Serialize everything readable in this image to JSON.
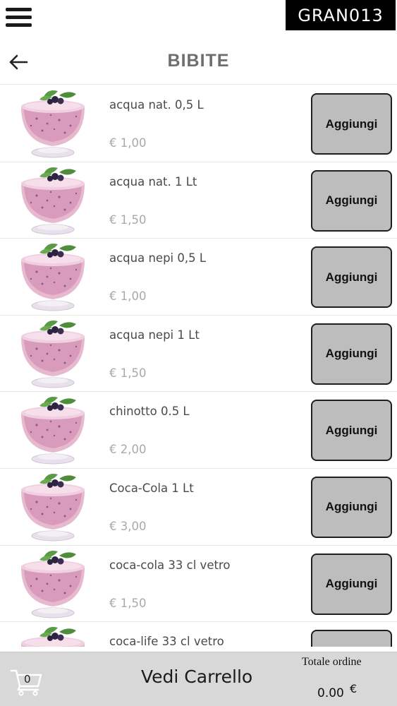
{
  "brand": {
    "logo_text": "GRAN013"
  },
  "header": {
    "title": "BIBITE"
  },
  "icons": {
    "menu": "hamburger-menu-icon",
    "back": "back-arrow-icon",
    "cart": "shopping-cart-icon",
    "product": "smoothie-glass-image"
  },
  "colors": {
    "button_bg": "#bdbdbd",
    "footer_bg": "#d8d8d8",
    "title": "#6e6e6e",
    "price": "#a9a9a9",
    "logo_bg": "#000000"
  },
  "products": [
    {
      "name": "acqua nat. 0,5 L",
      "price": "€ 1,00",
      "button": "Aggiungi"
    },
    {
      "name": "acqua nat. 1 Lt",
      "price": "€ 1,50",
      "button": "Aggiungi"
    },
    {
      "name": "acqua nepi 0,5 L",
      "price": "€ 1,00",
      "button": "Aggiungi"
    },
    {
      "name": "acqua nepi 1 Lt",
      "price": "€ 1,50",
      "button": "Aggiungi"
    },
    {
      "name": "chinotto 0.5 L",
      "price": "€ 2,00",
      "button": "Aggiungi"
    },
    {
      "name": "Coca-Cola 1 Lt",
      "price": "€ 3,00",
      "button": "Aggiungi"
    },
    {
      "name": "coca-cola 33 cl vetro",
      "price": "€ 1,50",
      "button": "Aggiungi"
    },
    {
      "name": "coca-life 33 cl vetro",
      "price": "",
      "button": ""
    }
  ],
  "footer": {
    "cart_count": "0",
    "view_cart": "Vedi Carrello",
    "total_label": "Totale ordine",
    "total_value": "0.00",
    "currency": "€"
  }
}
